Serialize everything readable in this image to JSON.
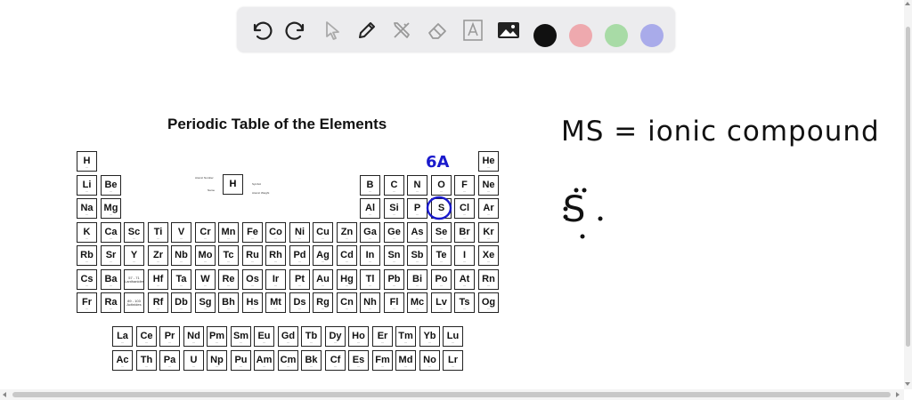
{
  "toolbar": {
    "tools": [
      "undo-icon",
      "redo-icon",
      "pointer-icon",
      "pen-icon",
      "tools-icon",
      "eraser-icon",
      "text-icon",
      "image-icon"
    ],
    "colors": [
      "#111111",
      "#eea9ae",
      "#a8dba6",
      "#a9abea"
    ]
  },
  "periodic_table": {
    "title": "Periodic Table of the Elements",
    "key": {
      "symbol": "H",
      "labels": [
        "Atomic Number",
        "Name",
        "Symbol",
        "Atomic Weight"
      ]
    },
    "rows": [
      [
        "H",
        "",
        "",
        "",
        "",
        "",
        "",
        "",
        "",
        "",
        "",
        "",
        "",
        "",
        "",
        "",
        "",
        "He"
      ],
      [
        "Li",
        "Be",
        "",
        "",
        "",
        "",
        "",
        "",
        "",
        "",
        "",
        "",
        "B",
        "C",
        "N",
        "O",
        "F",
        "Ne"
      ],
      [
        "Na",
        "Mg",
        "",
        "",
        "",
        "",
        "",
        "",
        "",
        "",
        "",
        "",
        "Al",
        "Si",
        "P",
        "S",
        "Cl",
        "Ar"
      ],
      [
        "K",
        "Ca",
        "Sc",
        "Ti",
        "V",
        "Cr",
        "Mn",
        "Fe",
        "Co",
        "Ni",
        "Cu",
        "Zn",
        "Ga",
        "Ge",
        "As",
        "Se",
        "Br",
        "Kr"
      ],
      [
        "Rb",
        "Sr",
        "Y",
        "Zr",
        "Nb",
        "Mo",
        "Tc",
        "Ru",
        "Rh",
        "Pd",
        "Ag",
        "Cd",
        "In",
        "Sn",
        "Sb",
        "Te",
        "I",
        "Xe"
      ],
      [
        "Cs",
        "Ba",
        "*",
        "Hf",
        "Ta",
        "W",
        "Re",
        "Os",
        "Ir",
        "Pt",
        "Au",
        "Hg",
        "Tl",
        "Pb",
        "Bi",
        "Po",
        "At",
        "Rn"
      ],
      [
        "Fr",
        "Ra",
        "**",
        "Rf",
        "Db",
        "Sg",
        "Bh",
        "Hs",
        "Mt",
        "Ds",
        "Rg",
        "Cn",
        "Nh",
        "Fl",
        "Mc",
        "Lv",
        "Ts",
        "Og"
      ]
    ],
    "lanthanides": [
      "La",
      "Ce",
      "Pr",
      "Nd",
      "Pm",
      "Sm",
      "Eu",
      "Gd",
      "Tb",
      "Dy",
      "Ho",
      "Er",
      "Tm",
      "Yb",
      "Lu"
    ],
    "actinides": [
      "Ac",
      "Th",
      "Pa",
      "U",
      "Np",
      "Pu",
      "Am",
      "Cm",
      "Bk",
      "Cf",
      "Es",
      "Fm",
      "Md",
      "No",
      "Lr"
    ],
    "placeholders": {
      "lanthanides": "57 - 71 Lanthanides",
      "actinides": "89 - 103 Actinides"
    }
  },
  "annotations": {
    "formula": "MS = ionic compound",
    "group_label": "6A",
    "lewis_symbol": "S",
    "highlight_color": "#1a1acc",
    "circled_element": "S"
  }
}
